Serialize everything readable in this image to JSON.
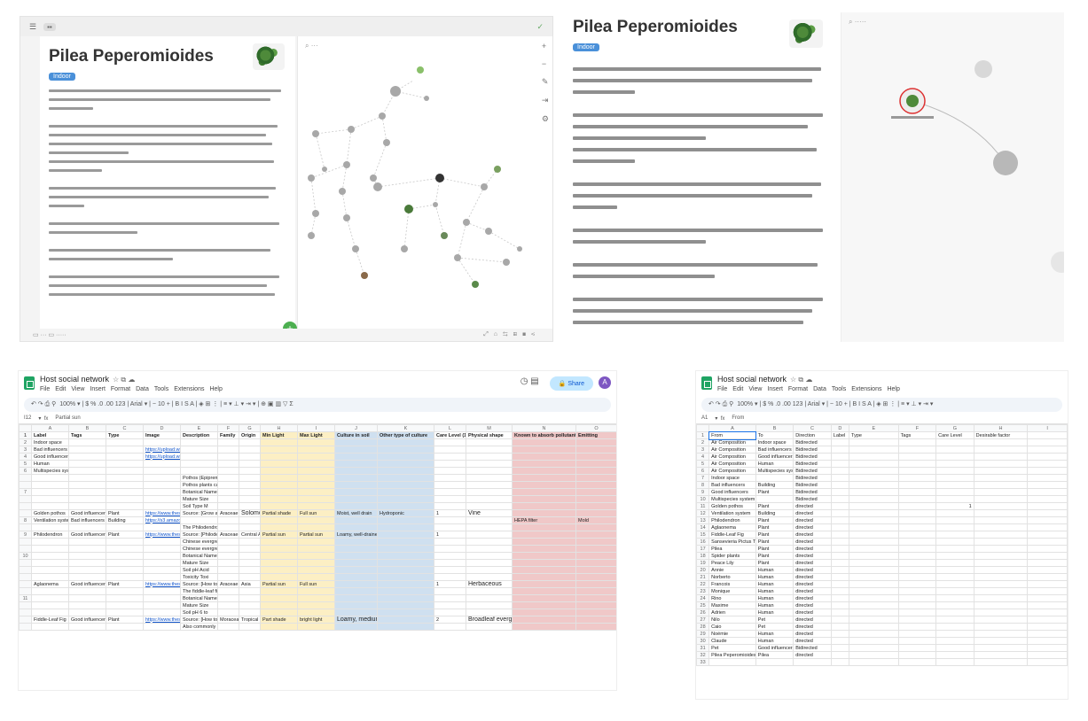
{
  "note": {
    "title": "Pilea Peperomioides",
    "badge": "Indoor"
  },
  "sheet": {
    "title": "Host social network",
    "menu": [
      "File",
      "Edit",
      "View",
      "Insert",
      "Format",
      "Data",
      "Tools",
      "Extensions",
      "Help"
    ],
    "share_label": "Share",
    "avatar_letter": "A",
    "zoom": "100%",
    "font": "Arial",
    "font_size": "10",
    "left_cell_ref": "I12",
    "left_fx": "Partial sun",
    "right_cell_ref": "A1",
    "right_fx": "From"
  },
  "left_sheet": {
    "columns": [
      "A",
      "B",
      "C",
      "D",
      "E",
      "F",
      "G",
      "H",
      "I",
      "J",
      "K",
      "L",
      "M",
      "N",
      "O"
    ],
    "header": [
      "Label",
      "Tags",
      "Type",
      "Image",
      "Description",
      "Family",
      "Origin",
      "Min Light",
      "Max Light",
      "Culture in soil",
      "Other type of culture",
      "Care Level (10",
      "Physical shape",
      "Known to absorb pollutant",
      "Emitting"
    ],
    "rows": [
      {
        "n": "2",
        "c": [
          "Indoor space",
          "",
          "",
          "",
          "",
          "",
          "",
          "",
          "",
          "",
          "",
          "",
          "",
          "",
          ""
        ]
      },
      {
        "n": "3",
        "c": [
          "Bad influencers",
          "",
          "",
          "https://upload.wiki",
          "",
          "",
          "",
          "",
          "",
          "",
          "",
          "",
          "",
          "",
          ""
        ]
      },
      {
        "n": "4",
        "c": [
          "Good influencers",
          "",
          "",
          "https://upload.wiki",
          "",
          "",
          "",
          "",
          "",
          "",
          "",
          "",
          "",
          "",
          ""
        ]
      },
      {
        "n": "5",
        "c": [
          "Human",
          "",
          "",
          "",
          "",
          "",
          "",
          "",
          "",
          "",
          "",
          "",
          "",
          "",
          ""
        ]
      },
      {
        "n": "6",
        "c": [
          "Multispecies system",
          "",
          "",
          "",
          "",
          "",
          "",
          "",
          "",
          "",
          "",
          "",
          "",
          "",
          ""
        ]
      },
      {
        "n": "",
        "c": [
          "",
          "",
          "",
          "",
          "Pothos (Epipremnum",
          "",
          "",
          "",
          "",
          "",
          "",
          "",
          "",
          "",
          ""
        ]
      },
      {
        "n": "",
        "c": [
          "",
          "",
          "",
          "",
          "Pothos plants ca",
          "",
          "",
          "",
          "",
          "",
          "",
          "",
          "",
          "",
          ""
        ]
      },
      {
        "n": "7",
        "c": [
          "",
          "",
          "",
          "",
          "Botanical Name",
          "",
          "",
          "",
          "",
          "",
          "",
          "",
          "",
          "",
          ""
        ]
      },
      {
        "n": "",
        "c": [
          "",
          "",
          "",
          "",
          "Mature Size",
          "",
          "",
          "",
          "",
          "",
          "",
          "",
          "",
          "",
          ""
        ]
      },
      {
        "n": "",
        "c": [
          "",
          "",
          "",
          "",
          "Soil Type      M",
          "",
          "",
          "",
          "",
          "",
          "",
          "",
          "",
          "",
          ""
        ]
      },
      {
        "n": "",
        "c": [
          "Golden pothos",
          "Good influencers",
          "Plant",
          "https://www.thesp",
          "Source: [Grow a",
          "Araceae",
          "Solomon",
          "Partial shade",
          "Full sun",
          "Moist, well drain",
          "Hydroponic",
          "1",
          "Vine",
          "",
          ""
        ]
      },
      {
        "n": "8",
        "c": [
          "Ventilation system",
          "Bad influencers",
          "Building",
          "https://s3.amazon",
          "",
          "",
          "",
          "",
          "",
          "",
          "",
          "",
          "",
          "HEPA filter",
          "Mold"
        ]
      },
      {
        "n": "",
        "c": [
          "",
          "",
          "",
          "",
          "The Philodendron",
          "",
          "",
          "",
          "",
          "",
          "",
          "",
          "",
          "",
          ""
        ]
      },
      {
        "n": "9",
        "c": [
          "Philodendron",
          "Good influencers",
          "Plant",
          "https://www.thesp",
          "Source: [Philodend",
          "Araceae",
          "Central A",
          "Partial sun",
          "Partial sun",
          "Loamy, well-drained",
          "",
          "1",
          "",
          "",
          ""
        ]
      },
      {
        "n": "",
        "c": [
          "",
          "",
          "",
          "",
          "Chinese evergreen",
          "",
          "",
          "",
          "",
          "",
          "",
          "",
          "",
          "",
          ""
        ]
      },
      {
        "n": "",
        "c": [
          "",
          "",
          "",
          "",
          "Chinese evergre",
          "",
          "",
          "",
          "",
          "",
          "",
          "",
          "",
          "",
          ""
        ]
      },
      {
        "n": "10",
        "c": [
          "",
          "",
          "",
          "",
          "Botanical Name",
          "",
          "",
          "",
          "",
          "",
          "",
          "",
          "",
          "",
          ""
        ]
      },
      {
        "n": "",
        "c": [
          "",
          "",
          "",
          "",
          "Mature Size",
          "",
          "",
          "",
          "",
          "",
          "",
          "",
          "",
          "",
          ""
        ]
      },
      {
        "n": "",
        "c": [
          "",
          "",
          "",
          "",
          "Soil pH        Acid",
          "",
          "",
          "",
          "",
          "",
          "",
          "",
          "",
          "",
          ""
        ]
      },
      {
        "n": "",
        "c": [
          "",
          "",
          "",
          "",
          "Toxicity       Toxi",
          "",
          "",
          "",
          "",
          "",
          "",
          "",
          "",
          "",
          ""
        ]
      },
      {
        "n": "",
        "c": [
          "Aglaonema",
          "Good influencers",
          "Plant",
          "https://www.thesp",
          "Source: [How to",
          "Araceae",
          "Asia",
          "Partial sun",
          "Full sun",
          "",
          "",
          "1",
          "Herbaceous",
          "",
          ""
        ]
      },
      {
        "n": "",
        "c": [
          "",
          "",
          "",
          "",
          "The fiddle-leaf fig",
          "",
          "",
          "",
          "",
          "",
          "",
          "",
          "",
          "",
          ""
        ]
      },
      {
        "n": "11",
        "c": [
          "",
          "",
          "",
          "",
          "Botanical Name",
          "",
          "",
          "",
          "",
          "",
          "",
          "",
          "",
          "",
          ""
        ]
      },
      {
        "n": "",
        "c": [
          "",
          "",
          "",
          "",
          "Mature Size",
          "",
          "",
          "",
          "",
          "",
          "",
          "",
          "",
          "",
          ""
        ]
      },
      {
        "n": "",
        "c": [
          "",
          "",
          "",
          "",
          "Soil pH        6 to",
          "",
          "",
          "",
          "",
          "",
          "",
          "",
          "",
          "",
          ""
        ]
      },
      {
        "n": "",
        "c": [
          "Fiddle-Leaf Fig",
          "Good influencers",
          "Plant",
          "https://www.thesp",
          "Source: [How to",
          "Moraceae",
          "Tropical W",
          "Part shade",
          "bright light",
          "Loamy, medium moisture, well-drai",
          "",
          "2",
          "Broadleaf evergreen",
          "",
          ""
        ]
      },
      {
        "n": "",
        "c": [
          "",
          "",
          "",
          "",
          "Also commonly k",
          "",
          "",
          "",
          "",
          "",
          "",
          "",
          "",
          "",
          ""
        ]
      }
    ]
  },
  "right_sheet": {
    "columns": [
      "A",
      "B",
      "C",
      "D",
      "E",
      "F",
      "G",
      "H",
      "I"
    ],
    "header": [
      "From",
      "To",
      "Direction",
      "Label",
      "Type",
      "Tags",
      "Care Level",
      "Desirable factor",
      ""
    ],
    "rows": [
      [
        "Air Composition",
        "Indoor space",
        "Bidirected"
      ],
      [
        "Air Composition",
        "Bad influencers",
        "Bidirected"
      ],
      [
        "Air Composition",
        "Good influencers",
        "Bidirected"
      ],
      [
        "Air Composition",
        "Human",
        "Bidirected"
      ],
      [
        "Air Composition",
        "Multispecies syst",
        "Bidirected"
      ],
      [
        "Indoor space",
        "",
        "Bidirected"
      ],
      [
        "Bad influencers",
        "Building",
        "Bidirected"
      ],
      [
        "Good influencers",
        "Plant",
        "Bidirected"
      ],
      [
        "Multispecies system",
        "",
        "Bidirected"
      ],
      [
        "Golden pothos",
        "Plant",
        "directed"
      ],
      [
        "Ventilation system",
        "Building",
        "directed"
      ],
      [
        "Philodendron",
        "Plant",
        "directed"
      ],
      [
        "Aglaonema",
        "Plant",
        "directed"
      ],
      [
        "Fiddle-Leaf Fig",
        "Plant",
        "directed"
      ],
      [
        "Sansevieria Pictus Tre",
        "Plant",
        "directed"
      ],
      [
        "Pilea",
        "Plant",
        "directed"
      ],
      [
        "Spider plants",
        "Plant",
        "directed"
      ],
      [
        "Peace Lily",
        "Plant",
        "directed"
      ],
      [
        "Annie",
        "Human",
        "directed"
      ],
      [
        "Norberto",
        "Human",
        "directed"
      ],
      [
        "Francois",
        "Human",
        "directed"
      ],
      [
        "Monique",
        "Human",
        "directed"
      ],
      [
        "Rino",
        "Human",
        "directed"
      ],
      [
        "Maxime",
        "Human",
        "directed"
      ],
      [
        "Adrien",
        "Human",
        "directed"
      ],
      [
        "Nilo",
        "Pet",
        "directed"
      ],
      [
        "Caio",
        "Pet",
        "directed"
      ],
      [
        "Noémie",
        "Human",
        "directed"
      ],
      [
        "Claude",
        "Human",
        "directed"
      ],
      [
        "Pet",
        "Good influencers",
        "Bidirected"
      ],
      [
        "Pilea Peperomioides",
        "Pilea",
        "directed"
      ],
      [
        "",
        "",
        ""
      ]
    ],
    "care_level_value": "1"
  },
  "colors": {
    "yellow": "#fcefc4",
    "blue": "#cfe0f0",
    "red": "#f0c8c8",
    "badge": "#4a90d9",
    "share": "#c2e7ff",
    "green": "#1fa463"
  }
}
